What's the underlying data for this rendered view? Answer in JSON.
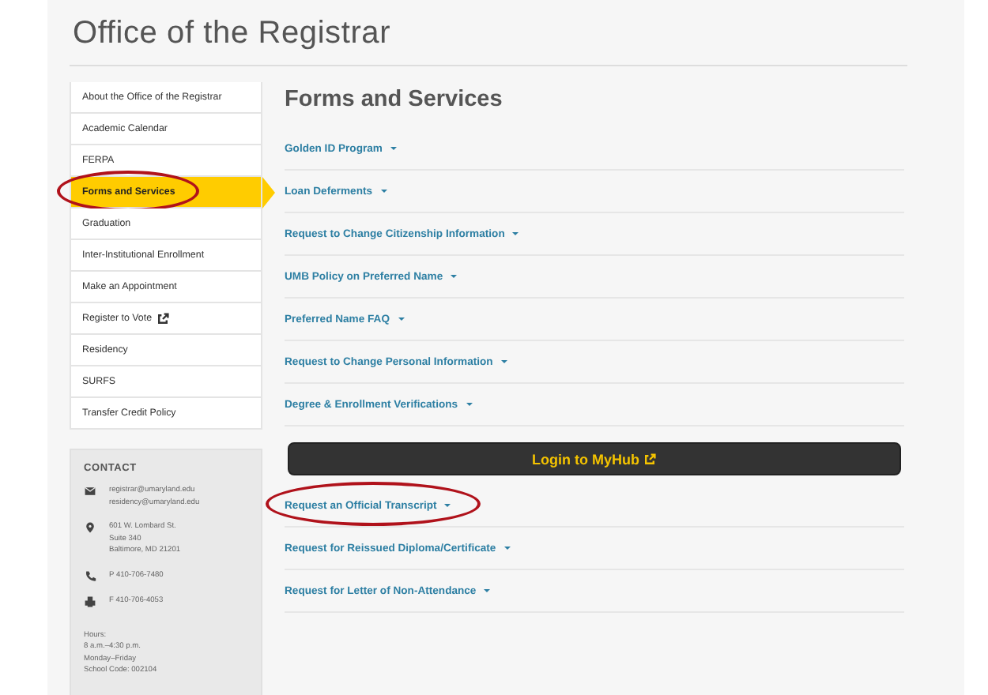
{
  "title": "Office of the Registrar",
  "sidebar": {
    "items": [
      {
        "label": "About the Office of the Registrar",
        "selected": false,
        "circled": false,
        "external": false
      },
      {
        "label": "Academic Calendar",
        "selected": false,
        "circled": false,
        "external": false
      },
      {
        "label": "FERPA",
        "selected": false,
        "circled": false,
        "external": false
      },
      {
        "label": "Forms and Services",
        "selected": true,
        "circled": true,
        "external": false
      },
      {
        "label": "Graduation",
        "selected": false,
        "circled": false,
        "external": false
      },
      {
        "label": "Inter-Institutional Enrollment",
        "selected": false,
        "circled": false,
        "external": false
      },
      {
        "label": "Make an Appointment",
        "selected": false,
        "circled": false,
        "external": false
      },
      {
        "label": "Register to Vote",
        "selected": false,
        "circled": false,
        "external": true
      },
      {
        "label": "Residency",
        "selected": false,
        "circled": false,
        "external": false
      },
      {
        "label": "SURFS",
        "selected": false,
        "circled": false,
        "external": false
      },
      {
        "label": "Transfer Credit Policy",
        "selected": false,
        "circled": false,
        "external": false
      }
    ]
  },
  "contact": {
    "heading": "CONTACT",
    "entries": [
      {
        "kind": "email",
        "lines": [
          "registrar@umaryland.edu",
          "residency@umaryland.edu"
        ]
      },
      {
        "kind": "address",
        "lines": [
          "601 W. Lombard St.",
          "Suite 340",
          "Baltimore, MD 21201"
        ]
      },
      {
        "kind": "phone",
        "lines": [
          "P 410-706-7480"
        ]
      },
      {
        "kind": "fax",
        "lines": [
          "F 410-706-4053"
        ]
      }
    ],
    "notes": [
      "Hours:",
      "8 a.m.–4:30 p.m.",
      "Monday–Friday",
      "School Code: 002104"
    ]
  },
  "main": {
    "heading": "Forms and Services",
    "items": [
      {
        "kind": "link",
        "label": "Golden ID Program",
        "circled": false
      },
      {
        "kind": "link",
        "label": "Loan Deferments",
        "circled": false
      },
      {
        "kind": "link",
        "label": "Request to Change Citizenship Information",
        "circled": false
      },
      {
        "kind": "link",
        "label": "UMB Policy on Preferred Name",
        "circled": false
      },
      {
        "kind": "link",
        "label": "Preferred Name FAQ",
        "circled": false
      },
      {
        "kind": "link",
        "label": "Request to Change Personal Information",
        "circled": false
      },
      {
        "kind": "link",
        "label": "Degree & Enrollment Verifications",
        "circled": false
      },
      {
        "kind": "button",
        "label": "Login to MyHub",
        "circled": false
      },
      {
        "kind": "link",
        "label": "Request an Official Transcript",
        "circled": true
      },
      {
        "kind": "link",
        "label": "Request for Reissued Diploma/Certificate",
        "circled": false
      },
      {
        "kind": "link",
        "label": "Request for Letter of Non-Attendance",
        "circled": false
      }
    ]
  }
}
